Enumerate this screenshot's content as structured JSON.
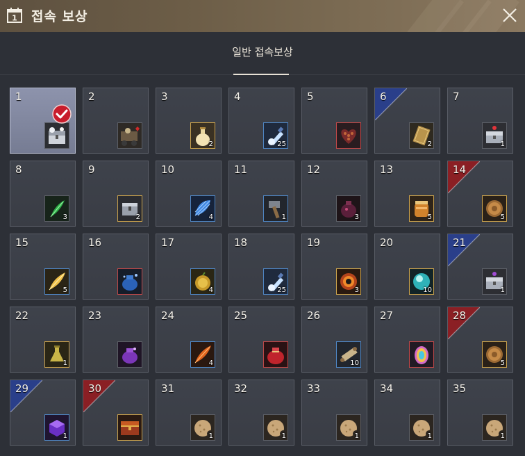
{
  "window": {
    "title": "접속 보상",
    "close_icon": "close-icon"
  },
  "tabs": [
    {
      "label": "일반 접속보상",
      "active": true
    }
  ],
  "colors": {
    "titlebar": "#6c5d47",
    "panel": "#2d3037",
    "cell": "#3c4048",
    "claimed_cell": "#868ca3",
    "ribbon_blue": "#2a3f8a",
    "ribbon_red": "#8b1f24",
    "check_red": "#c81d2c"
  },
  "rewards": [
    {
      "day": "1",
      "item": "silver-chest",
      "qty": "",
      "claimed": true
    },
    {
      "day": "2",
      "item": "treasure-cart",
      "qty": "",
      "frame": "grey"
    },
    {
      "day": "3",
      "item": "potion-bottle",
      "qty": "2",
      "frame": "gold"
    },
    {
      "day": "4",
      "item": "blue-vial",
      "qty": "25",
      "frame": "blue"
    },
    {
      "day": "5",
      "item": "heart-box",
      "qty": "",
      "frame": "red"
    },
    {
      "day": "6",
      "item": "gold-card",
      "qty": "2",
      "frame": "grey",
      "ribbon": "blue"
    },
    {
      "day": "7",
      "item": "red-gem-chest",
      "qty": "1",
      "frame": "grey"
    },
    {
      "day": "8",
      "item": "green-feather",
      "qty": "3",
      "frame": "grey"
    },
    {
      "day": "9",
      "item": "silver-box",
      "qty": "2",
      "frame": "gold"
    },
    {
      "day": "10",
      "item": "blue-shell",
      "qty": "4",
      "frame": "blue"
    },
    {
      "day": "11",
      "item": "hammer",
      "qty": "1",
      "frame": "blue"
    },
    {
      "day": "12",
      "item": "dark-pouch",
      "qty": "3",
      "frame": "grey"
    },
    {
      "day": "13",
      "item": "honey-jar",
      "qty": "5",
      "frame": "gold"
    },
    {
      "day": "14",
      "item": "bronze-coin",
      "qty": "5",
      "frame": "gold",
      "ribbon": "red"
    },
    {
      "day": "15",
      "item": "gold-feather",
      "qty": "5",
      "frame": "blue"
    },
    {
      "day": "16",
      "item": "blue-sack",
      "qty": "",
      "frame": "red"
    },
    {
      "day": "17",
      "item": "golden-fruit",
      "qty": "4",
      "frame": "blue"
    },
    {
      "day": "18",
      "item": "blue-vial",
      "qty": "25",
      "frame": "blue"
    },
    {
      "day": "19",
      "item": "fire-orb",
      "qty": "3",
      "frame": "gold"
    },
    {
      "day": "20",
      "item": "cyan-orb",
      "qty": "10",
      "frame": "gold"
    },
    {
      "day": "21",
      "item": "purple-gem-chest",
      "qty": "1",
      "frame": "grey",
      "ribbon": "blue"
    },
    {
      "day": "22",
      "item": "yellow-flask",
      "qty": "1",
      "frame": "gold"
    },
    {
      "day": "23",
      "item": "purple-sack",
      "qty": "",
      "frame": "grey"
    },
    {
      "day": "24",
      "item": "fire-feather",
      "qty": "4",
      "frame": "blue"
    },
    {
      "day": "25",
      "item": "red-sack",
      "qty": "",
      "frame": "red"
    },
    {
      "day": "26",
      "item": "scroll",
      "qty": "10",
      "frame": "blue"
    },
    {
      "day": "27",
      "item": "rainbow-egg",
      "qty": "",
      "frame": "red"
    },
    {
      "day": "28",
      "item": "bronze-coin",
      "qty": "5",
      "frame": "gold",
      "ribbon": "red"
    },
    {
      "day": "29",
      "item": "purple-cube",
      "qty": "1",
      "frame": "blue",
      "ribbon": "blue"
    },
    {
      "day": "30",
      "item": "gold-chest",
      "qty": "",
      "frame": "gold",
      "ribbon": "red"
    },
    {
      "day": "31",
      "item": "cookie",
      "qty": "1",
      "frame": "grey"
    },
    {
      "day": "32",
      "item": "cookie",
      "qty": "1",
      "frame": "grey"
    },
    {
      "day": "33",
      "item": "cookie",
      "qty": "1",
      "frame": "grey"
    },
    {
      "day": "34",
      "item": "cookie",
      "qty": "1",
      "frame": "grey"
    },
    {
      "day": "35",
      "item": "cookie",
      "qty": "1",
      "frame": "grey"
    }
  ]
}
